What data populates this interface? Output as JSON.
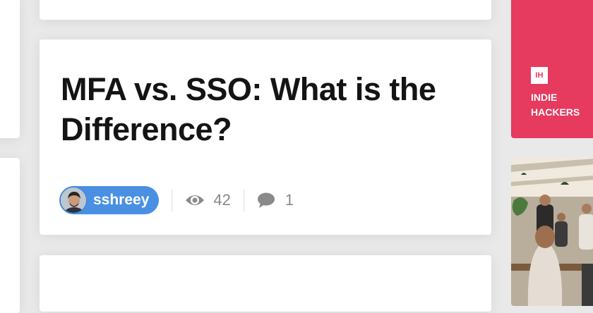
{
  "post": {
    "title": "MFA vs. SSO: What is the Difference?",
    "author": "sshreey",
    "views": "42",
    "comments": "1"
  },
  "ad": {
    "logo_text": "IH",
    "name_line1": "INDIE",
    "name_line2": "HACKERS",
    "color": "#e73a5f"
  },
  "icons": {
    "views": "eye-icon",
    "comments": "comment-bubble-icon"
  },
  "colors": {
    "author_pill": "#4a90e2",
    "background": "#e9e9e9",
    "card": "#ffffff"
  }
}
